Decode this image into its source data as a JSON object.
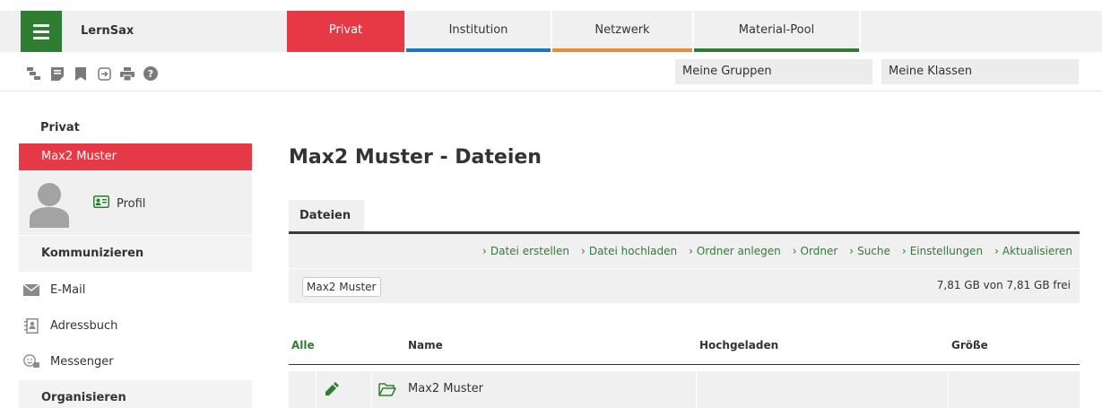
{
  "app": {
    "name": "LernSax"
  },
  "nav": {
    "tabs": [
      {
        "label": "Privat"
      },
      {
        "label": "Institution"
      },
      {
        "label": "Netzwerk"
      },
      {
        "label": "Material-Pool"
      }
    ]
  },
  "quick": {
    "groups": "Meine Gruppen",
    "classes": "Meine Klassen"
  },
  "toolbar_icons": [
    "sitemap-icon",
    "notes-icon",
    "bookmark-icon",
    "logout-icon",
    "print-icon",
    "help-icon"
  ],
  "sidebar": {
    "title": "Privat",
    "user": "Max2 Muster",
    "profile_label": "Profil",
    "sections": {
      "communicate": "Kommunizieren",
      "organize": "Organisieren"
    },
    "items": [
      {
        "label": "E-Mail",
        "icon": "mail-icon"
      },
      {
        "label": "Adressbuch",
        "icon": "address-book-icon"
      },
      {
        "label": "Messenger",
        "icon": "messenger-icon"
      }
    ]
  },
  "main": {
    "title": "Max2 Muster - Dateien",
    "tab": "Dateien",
    "actions": [
      "Datei erstellen",
      "Datei hochladen",
      "Ordner anlegen",
      "Ordner",
      "Suche",
      "Einstellungen",
      "Aktualisieren"
    ],
    "breadcrumb": "Max2 Muster",
    "quota": "7,81 GB von 7,81 GB frei",
    "table": {
      "headers": {
        "all": "Alle",
        "name": "Name",
        "uploaded": "Hochgeladen",
        "size": "Größe"
      },
      "rows": [
        {
          "name": "Max2 Muster",
          "uploaded": "",
          "size": ""
        }
      ]
    }
  },
  "colors": {
    "brand_green": "#2f7d32",
    "private_red": "#e63946",
    "institution_blue": "#1a78c2",
    "network_orange": "#ea8a3a"
  }
}
